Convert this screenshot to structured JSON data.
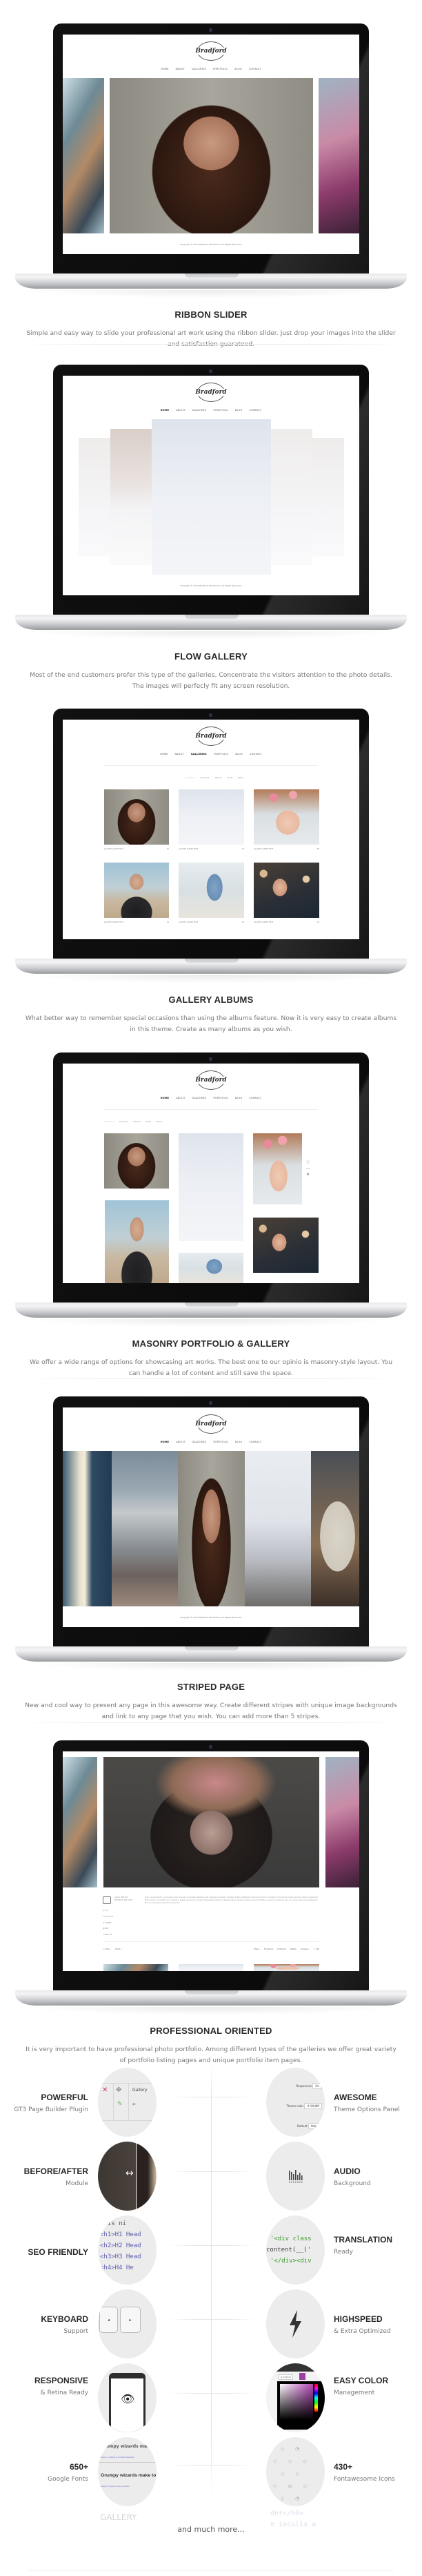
{
  "site": {
    "logo_text": "Bradford",
    "nav": [
      "Home",
      "About",
      "Galleries",
      "Portfolio",
      "Blog",
      "Contact"
    ],
    "footer": "Copyright © 2015 Bradford WP Theme. All Rights Reserved."
  },
  "sections": [
    {
      "title": "RIBBON SLIDER",
      "description": "Simple  and easy way to slide your professional art work using the ribbon slider. Just drop your images into the slider and satisfaction guarateed."
    },
    {
      "title": "FLOW GALLERY",
      "description": "Most of the end customers prefer this type of the galleries. Concentrate the visitors attention to the photo details. The images will perfecly fit any screen resolution."
    },
    {
      "title": "GALLERY ALBUMS",
      "description": "What better way to remember special occasions than using the albums feature. Now it is very easy to create albums in this theme. Create as many albums as you wish.",
      "filters": [
        "All Works",
        "Portraits",
        "Nature",
        "Stuff",
        "Other"
      ],
      "albums": [
        {
          "title": "GALLERY ALBUM TITLE",
          "photos": "10",
          "likes": "216"
        },
        {
          "title": "GALLERY ALBUM TITLE",
          "photos": "26",
          "likes": "216"
        },
        {
          "title": "GALLERY ALBUM TITLE",
          "photos": "86",
          "likes": "216"
        },
        {
          "title": "GALLERY ALBUM TITLE",
          "photos": "24",
          "likes": "216"
        },
        {
          "title": "GALLERY ALBUM TITLE",
          "photos": "14",
          "likes": "216"
        },
        {
          "title": "GALLERY ALBUM TITLE",
          "photos": "10",
          "likes": "216"
        }
      ]
    },
    {
      "title": "MASONRY PORTFOLIO & GALLERY",
      "description": "We offer a wide range of options for showcasing art works. The best one to our opinio is masonry-style layout. You can handle a lot of content and still save the space.",
      "filters": [
        "All Works",
        "Portraits",
        "Nature",
        "Stuff",
        "Other"
      ],
      "like_count": "216"
    },
    {
      "title": "STRIPED PAGE",
      "description": "New and cool way to present any page in this awesome way. Create different stripes with unique image backgrounds and link to any page that you wish. You can add more than 5 stripes."
    },
    {
      "title": "PROFESSIONAL ORIENTED",
      "description": "It is very important to have professional photo portfolio. Among different types of the galleries we offer great variety of portfolio listing pages and unique portfolio item pages.",
      "camera": {
        "model": "Canon EOS 7D",
        "lens": "EF135mm f/2L USM",
        "aperture": "2.0",
        "focal": "135.0 mm",
        "shutter": "1/8000",
        "iso": "640",
        "flash": "Flash off"
      },
      "body_text": "Enim congue blandit. Lorem ipsum dolor sit amet, consectetur adipiscing elit. Quisque consectetur interdum finibus. Vestibulum ante ipsum primis in faucibus orci luctus et ultrices posuere cubilia curae blandit finibus ipsum, id porttitor arcu volutpat a. Integer iaculis erat nec justo malesuada faucibus vel tempus sapien. Vivamus aliquam euismod tristique. Aenean non tempus odio, non varius nulla aprion eget lectus quis mi consectetur bibendum at at lectus.",
      "nav": {
        "prev": "Prev",
        "next": "Next"
      },
      "share": [
        "Share:",
        "Facebook",
        "Pinterest",
        "Twitter",
        "Google+"
      ],
      "likes": "216"
    }
  ],
  "features": [
    {
      "side": "left",
      "title": "POWERFUL",
      "sub": "GT3 Page Builder Plugin",
      "icon": "page-builder-icon",
      "mock": {
        "label": "Gallery"
      }
    },
    {
      "side": "right",
      "title": "AWESOME",
      "sub": "Theme Options Panel",
      "icon": "theme-options-icon",
      "mock": {
        "rows": [
          [
            "Responsive",
            "On"
          ],
          [
            "Theme color",
            "# 00d8ff"
          ],
          [
            "Default",
            "http://"
          ]
        ]
      }
    },
    {
      "side": "left",
      "title": "BEFORE/AFTER",
      "sub": "Module",
      "icon": "before-after-icon"
    },
    {
      "side": "right",
      "title": "AUDIO",
      "sub": "Background",
      "icon": "audio-icon"
    },
    {
      "side": "left",
      "title": "SEO FRIENDLY",
      "sub": "",
      "icon": "code-headings-icon",
      "mock": {
        "lines": [
          "atis ni",
          "<h1>H1 Head",
          "<h2>H2 Head",
          "<h3>H3 Head",
          "<h4>H4 He"
        ]
      }
    },
    {
      "side": "right",
      "title": "TRANSLATION",
      "sub": "Ready",
      "icon": "translation-code-icon",
      "mock": {
        "lines": [
          "'<div class",
          "content(__('",
          "'</div><div"
        ]
      }
    },
    {
      "side": "left",
      "title": "KEYBOARD",
      "sub": "Support",
      "icon": "keyboard-icon"
    },
    {
      "side": "right",
      "title": "HIGHSPEED",
      "sub": "& Extra Optimized",
      "icon": "lightning-icon"
    },
    {
      "side": "left",
      "title": "RESPONSIVE",
      "sub": "& Retina Ready",
      "icon": "phone-eye-icon"
    },
    {
      "side": "right",
      "title": "EASY COLOR",
      "sub": "Management",
      "icon": "color-picker-icon",
      "mock": {
        "hex": "# d16432"
      }
    },
    {
      "side": "left",
      "title": "650+",
      "sub": "Google Fonts",
      "icon": "google-fonts-icon",
      "mock": {
        "lines": [
          "Grumpy wizards make",
          "Roboto, 12 Styles by Christian Robertson",
          "Grumpy wizards make tox",
          "Oswald, 3 Styles by Vernon Adams"
        ]
      }
    },
    {
      "side": "right",
      "title": "430+",
      "sub": "Fontawesome Icons",
      "icon": "fontawesome-icon"
    }
  ],
  "footer": {
    "more": "and much more...",
    "ghost_left": "GALLERY",
    "ghost_right": [
      "der</h6>",
      "e iaculis a"
    ]
  }
}
